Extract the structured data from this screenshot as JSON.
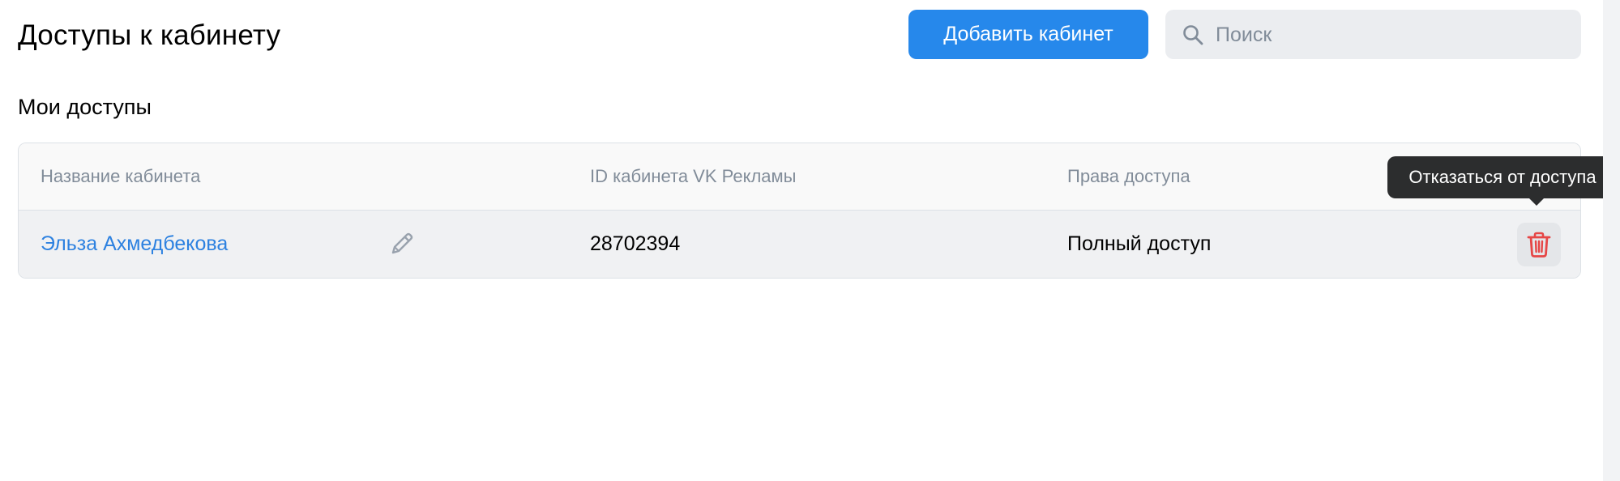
{
  "header": {
    "title": "Доступы к кабинету",
    "add_button_label": "Добавить кабинет",
    "search": {
      "placeholder": "Поиск",
      "value": ""
    }
  },
  "section": {
    "title": "Мои доступы"
  },
  "table": {
    "columns": [
      "Название кабинета",
      "ID кабинета VK Рекламы",
      "Права доступа"
    ],
    "rows": [
      {
        "name": "Эльза Ахмедбекова",
        "account_id": "28702394",
        "access": "Полный доступ"
      }
    ]
  },
  "tooltip": {
    "text": "Отказаться от доступа"
  },
  "icons": {
    "search": "search-icon",
    "edit": "pencil-icon",
    "delete": "trash-icon"
  },
  "colors": {
    "accent": "#2688eb",
    "link": "#2d81e0",
    "danger": "#e64646",
    "secondary_text": "#818c99"
  }
}
